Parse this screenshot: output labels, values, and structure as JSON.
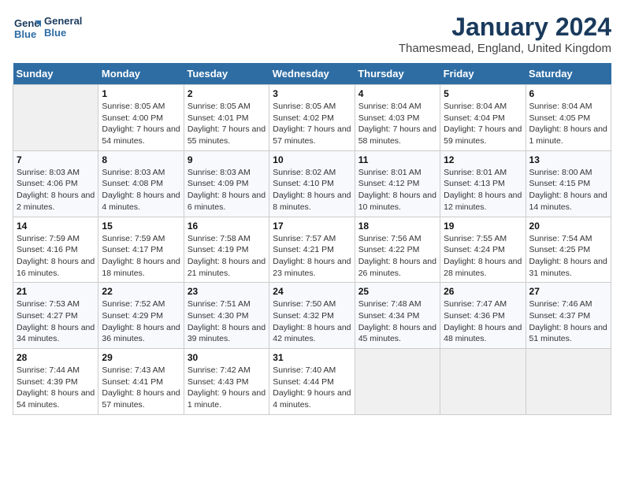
{
  "logo": {
    "line1": "General",
    "line2": "Blue"
  },
  "title": "January 2024",
  "location": "Thamesmead, England, United Kingdom",
  "days_of_week": [
    "Sunday",
    "Monday",
    "Tuesday",
    "Wednesday",
    "Thursday",
    "Friday",
    "Saturday"
  ],
  "weeks": [
    [
      {
        "day": "",
        "sunrise": "",
        "sunset": "",
        "daylight": ""
      },
      {
        "day": "1",
        "sunrise": "Sunrise: 8:05 AM",
        "sunset": "Sunset: 4:00 PM",
        "daylight": "Daylight: 7 hours and 54 minutes."
      },
      {
        "day": "2",
        "sunrise": "Sunrise: 8:05 AM",
        "sunset": "Sunset: 4:01 PM",
        "daylight": "Daylight: 7 hours and 55 minutes."
      },
      {
        "day": "3",
        "sunrise": "Sunrise: 8:05 AM",
        "sunset": "Sunset: 4:02 PM",
        "daylight": "Daylight: 7 hours and 57 minutes."
      },
      {
        "day": "4",
        "sunrise": "Sunrise: 8:04 AM",
        "sunset": "Sunset: 4:03 PM",
        "daylight": "Daylight: 7 hours and 58 minutes."
      },
      {
        "day": "5",
        "sunrise": "Sunrise: 8:04 AM",
        "sunset": "Sunset: 4:04 PM",
        "daylight": "Daylight: 7 hours and 59 minutes."
      },
      {
        "day": "6",
        "sunrise": "Sunrise: 8:04 AM",
        "sunset": "Sunset: 4:05 PM",
        "daylight": "Daylight: 8 hours and 1 minute."
      }
    ],
    [
      {
        "day": "7",
        "sunrise": "Sunrise: 8:03 AM",
        "sunset": "Sunset: 4:06 PM",
        "daylight": "Daylight: 8 hours and 2 minutes."
      },
      {
        "day": "8",
        "sunrise": "Sunrise: 8:03 AM",
        "sunset": "Sunset: 4:08 PM",
        "daylight": "Daylight: 8 hours and 4 minutes."
      },
      {
        "day": "9",
        "sunrise": "Sunrise: 8:03 AM",
        "sunset": "Sunset: 4:09 PM",
        "daylight": "Daylight: 8 hours and 6 minutes."
      },
      {
        "day": "10",
        "sunrise": "Sunrise: 8:02 AM",
        "sunset": "Sunset: 4:10 PM",
        "daylight": "Daylight: 8 hours and 8 minutes."
      },
      {
        "day": "11",
        "sunrise": "Sunrise: 8:01 AM",
        "sunset": "Sunset: 4:12 PM",
        "daylight": "Daylight: 8 hours and 10 minutes."
      },
      {
        "day": "12",
        "sunrise": "Sunrise: 8:01 AM",
        "sunset": "Sunset: 4:13 PM",
        "daylight": "Daylight: 8 hours and 12 minutes."
      },
      {
        "day": "13",
        "sunrise": "Sunrise: 8:00 AM",
        "sunset": "Sunset: 4:15 PM",
        "daylight": "Daylight: 8 hours and 14 minutes."
      }
    ],
    [
      {
        "day": "14",
        "sunrise": "Sunrise: 7:59 AM",
        "sunset": "Sunset: 4:16 PM",
        "daylight": "Daylight: 8 hours and 16 minutes."
      },
      {
        "day": "15",
        "sunrise": "Sunrise: 7:59 AM",
        "sunset": "Sunset: 4:17 PM",
        "daylight": "Daylight: 8 hours and 18 minutes."
      },
      {
        "day": "16",
        "sunrise": "Sunrise: 7:58 AM",
        "sunset": "Sunset: 4:19 PM",
        "daylight": "Daylight: 8 hours and 21 minutes."
      },
      {
        "day": "17",
        "sunrise": "Sunrise: 7:57 AM",
        "sunset": "Sunset: 4:21 PM",
        "daylight": "Daylight: 8 hours and 23 minutes."
      },
      {
        "day": "18",
        "sunrise": "Sunrise: 7:56 AM",
        "sunset": "Sunset: 4:22 PM",
        "daylight": "Daylight: 8 hours and 26 minutes."
      },
      {
        "day": "19",
        "sunrise": "Sunrise: 7:55 AM",
        "sunset": "Sunset: 4:24 PM",
        "daylight": "Daylight: 8 hours and 28 minutes."
      },
      {
        "day": "20",
        "sunrise": "Sunrise: 7:54 AM",
        "sunset": "Sunset: 4:25 PM",
        "daylight": "Daylight: 8 hours and 31 minutes."
      }
    ],
    [
      {
        "day": "21",
        "sunrise": "Sunrise: 7:53 AM",
        "sunset": "Sunset: 4:27 PM",
        "daylight": "Daylight: 8 hours and 34 minutes."
      },
      {
        "day": "22",
        "sunrise": "Sunrise: 7:52 AM",
        "sunset": "Sunset: 4:29 PM",
        "daylight": "Daylight: 8 hours and 36 minutes."
      },
      {
        "day": "23",
        "sunrise": "Sunrise: 7:51 AM",
        "sunset": "Sunset: 4:30 PM",
        "daylight": "Daylight: 8 hours and 39 minutes."
      },
      {
        "day": "24",
        "sunrise": "Sunrise: 7:50 AM",
        "sunset": "Sunset: 4:32 PM",
        "daylight": "Daylight: 8 hours and 42 minutes."
      },
      {
        "day": "25",
        "sunrise": "Sunrise: 7:48 AM",
        "sunset": "Sunset: 4:34 PM",
        "daylight": "Daylight: 8 hours and 45 minutes."
      },
      {
        "day": "26",
        "sunrise": "Sunrise: 7:47 AM",
        "sunset": "Sunset: 4:36 PM",
        "daylight": "Daylight: 8 hours and 48 minutes."
      },
      {
        "day": "27",
        "sunrise": "Sunrise: 7:46 AM",
        "sunset": "Sunset: 4:37 PM",
        "daylight": "Daylight: 8 hours and 51 minutes."
      }
    ],
    [
      {
        "day": "28",
        "sunrise": "Sunrise: 7:44 AM",
        "sunset": "Sunset: 4:39 PM",
        "daylight": "Daylight: 8 hours and 54 minutes."
      },
      {
        "day": "29",
        "sunrise": "Sunrise: 7:43 AM",
        "sunset": "Sunset: 4:41 PM",
        "daylight": "Daylight: 8 hours and 57 minutes."
      },
      {
        "day": "30",
        "sunrise": "Sunrise: 7:42 AM",
        "sunset": "Sunset: 4:43 PM",
        "daylight": "Daylight: 9 hours and 1 minute."
      },
      {
        "day": "31",
        "sunrise": "Sunrise: 7:40 AM",
        "sunset": "Sunset: 4:44 PM",
        "daylight": "Daylight: 9 hours and 4 minutes."
      },
      {
        "day": "",
        "sunrise": "",
        "sunset": "",
        "daylight": ""
      },
      {
        "day": "",
        "sunrise": "",
        "sunset": "",
        "daylight": ""
      },
      {
        "day": "",
        "sunrise": "",
        "sunset": "",
        "daylight": ""
      }
    ]
  ]
}
